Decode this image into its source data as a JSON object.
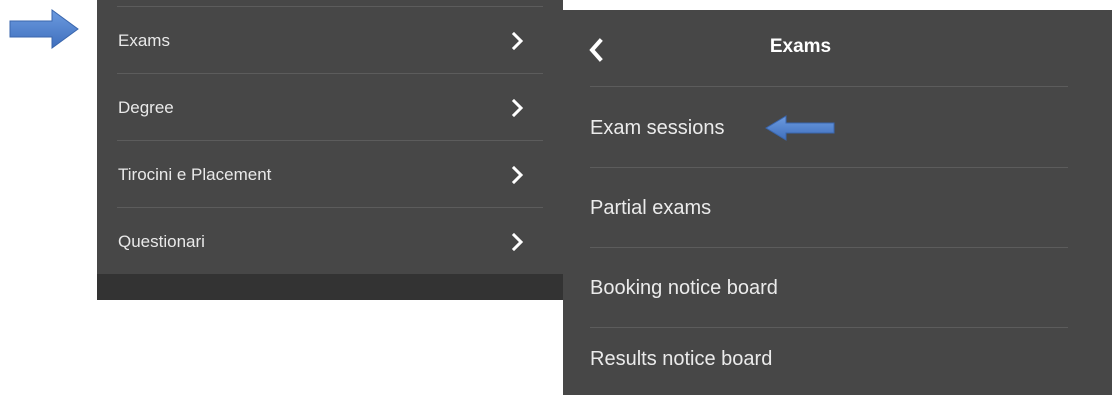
{
  "left_menu": {
    "items": [
      {
        "label": "Exams"
      },
      {
        "label": "Degree"
      },
      {
        "label": "Tirocini e Placement"
      },
      {
        "label": "Questionari"
      }
    ]
  },
  "right_menu": {
    "title": "Exams",
    "items": [
      {
        "label": "Exam sessions"
      },
      {
        "label": "Partial exams"
      },
      {
        "label": "Booking notice board"
      },
      {
        "label": "Results notice board"
      }
    ]
  },
  "colors": {
    "panel": "#474747",
    "panel_footer": "#333333",
    "separator": "#5c5c5c",
    "arrow": "#4a7cc9"
  },
  "icons": {
    "chevron": "chevron-right-icon",
    "back": "chevron-left-icon",
    "pointer": "arrow-annotation-icon"
  }
}
